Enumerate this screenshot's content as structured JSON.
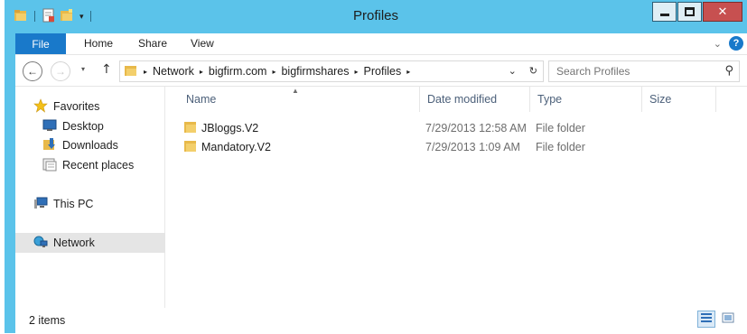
{
  "window": {
    "title": "Profiles"
  },
  "quick_access": {
    "icons": [
      "folder-icon",
      "properties-icon",
      "new-folder-icon"
    ],
    "dropdown": "▾"
  },
  "controls": {
    "minimize": "minimize",
    "maximize": "maximize",
    "close": "✕"
  },
  "ribbon": {
    "file_tab": "File",
    "tabs": [
      "Home",
      "Share",
      "View"
    ],
    "expand": "⌄",
    "help": "?"
  },
  "address_bar": {
    "back": "←",
    "forward": "→",
    "recent": "▾",
    "up": "↑",
    "breadcrumbs": [
      "Network",
      "bigfirm.com",
      "bigfirmshares",
      "Profiles"
    ],
    "separator": "▸",
    "dropdown": "⌄",
    "refresh": "↻"
  },
  "search": {
    "placeholder": "Search Profiles",
    "icon": "⚲"
  },
  "nav_pane": {
    "favorites": "Favorites",
    "favorites_items": [
      "Desktop",
      "Downloads",
      "Recent places"
    ],
    "this_pc": "This PC",
    "network": "Network"
  },
  "columns": {
    "name": "Name",
    "date_modified": "Date modified",
    "type": "Type",
    "size": "Size",
    "sort": "▲"
  },
  "files": [
    {
      "name": "JBloggs.V2",
      "date": "7/29/2013 12:58 AM",
      "type": "File folder"
    },
    {
      "name": "Mandatory.V2",
      "date": "7/29/2013 1:09 AM",
      "type": "File folder"
    }
  ],
  "status": {
    "count": "2 items"
  },
  "colors": {
    "titlebar": "#5bc3ea",
    "file_tab": "#1979ca",
    "close": "#c75050",
    "selection": "#e5e5e5",
    "folder": "#e8b94a"
  }
}
